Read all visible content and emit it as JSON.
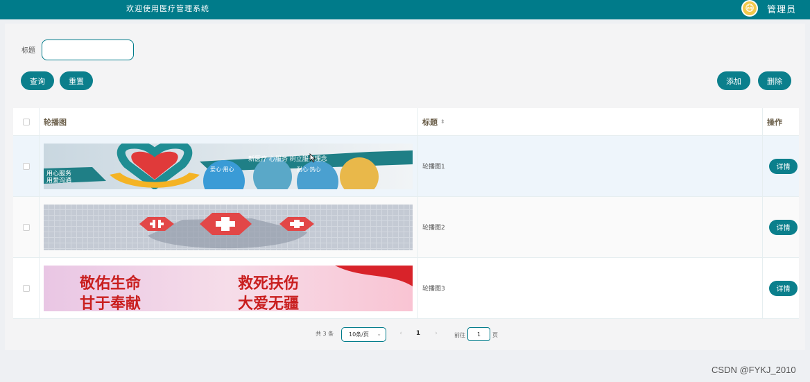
{
  "header": {
    "welcome_text": "欢迎使用医疗管理系统",
    "avatar_glyph": "😷",
    "username": "管理员",
    "bg_color": "#007b8a"
  },
  "search": {
    "label": "标题",
    "value": "",
    "placeholder": ""
  },
  "toolbar": {
    "query_label": "查询",
    "reset_label": "重置",
    "add_label": "添加",
    "delete_label": "删除"
  },
  "table": {
    "columns": [
      "轮播图",
      "标题",
      "操作"
    ],
    "sort_icon": "⬍",
    "rows": [
      {
        "title": "轮播图1",
        "detail_label": "详情",
        "banner": {
          "left_text_1": "用心服务",
          "left_text_2": "用爱沟通",
          "headline": "新医疗 心服务 树立服务理念",
          "tags": [
            "爱心·用心",
            "耐心·热心"
          ]
        }
      },
      {
        "title": "轮播图2",
        "detail_label": "详情"
      },
      {
        "title": "轮播图3",
        "detail_label": "详情",
        "banner": {
          "line1a": "敬佑生命",
          "line1b": "救死扶伤",
          "line2a": "甘于奉献",
          "line2b": "大爱无疆"
        }
      }
    ]
  },
  "pagination": {
    "total_text": "共 3 条",
    "page_size": "10条/页",
    "prev": "‹",
    "current_page": "1",
    "next": "›",
    "jump_label": "前往",
    "jump_value": "1",
    "jump_suffix": "页"
  },
  "watermark": "CSDN @FYKJ_2010"
}
